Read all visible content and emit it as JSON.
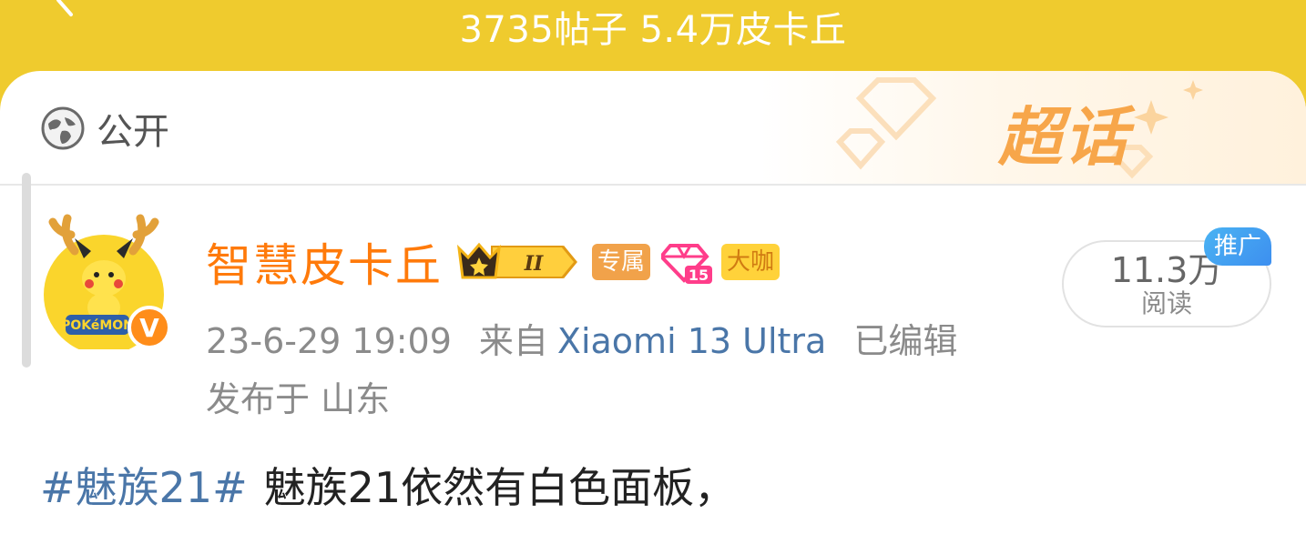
{
  "header": {
    "stats_text": "3735帖子 5.4万皮卡丘",
    "back_icon": "chevron-left-icon"
  },
  "card": {
    "visibility_label": "公开",
    "visibility_icon": "globe-icon",
    "supertopic_logo": "超话"
  },
  "author": {
    "name": "智慧皮卡丘",
    "avatar_logo_text": "POKéMON",
    "avatar_badge_text": "V",
    "crown_level": "II",
    "tag_exclusive": "专属",
    "gem_level": "15",
    "tag_daka": "大咖"
  },
  "meta": {
    "datetime": "23-6-29 19:09",
    "source_prefix": "来自",
    "device": "Xiaomi 13 Ultra",
    "edited": "已编辑",
    "location": "发布于 山东"
  },
  "stats": {
    "read_count": "11.3万",
    "read_label": "阅读",
    "promo_label": "推广"
  },
  "post": {
    "hashtag": "#魅族21#",
    "text": "魅族21依然有白色面板，"
  },
  "colors": {
    "brand_yellow": "#efcb2e",
    "username_orange": "#ff7a0a",
    "link_blue": "#4a76a8",
    "promo_blue": "#3d8ff0"
  }
}
